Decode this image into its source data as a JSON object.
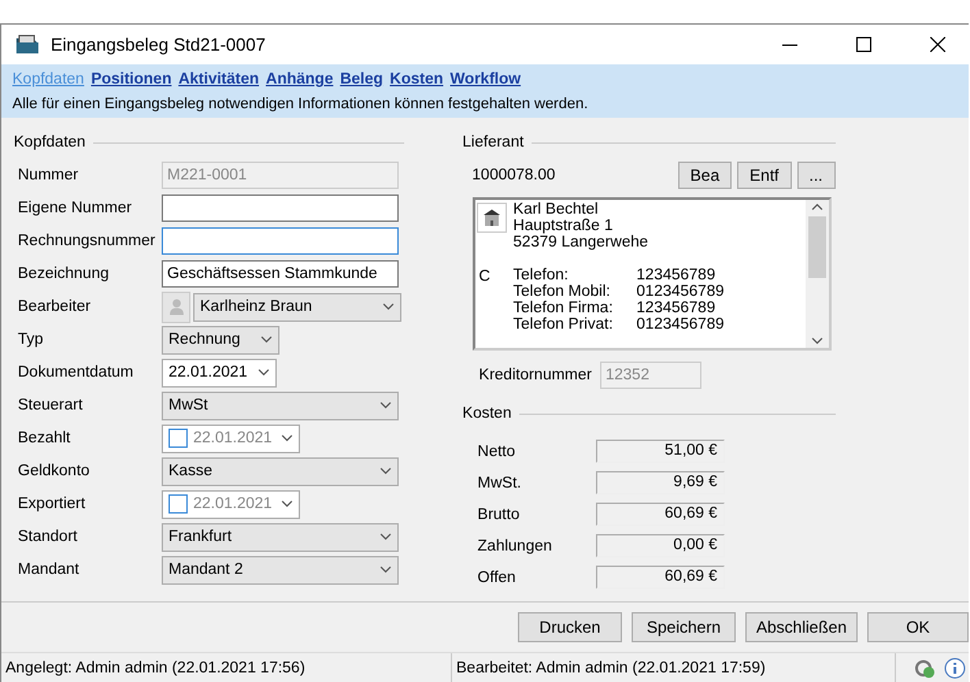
{
  "window": {
    "title": "Eingangsbeleg Std21-0007"
  },
  "nav": {
    "links": [
      {
        "label": "Kopfdaten",
        "selected": true
      },
      {
        "label": "Positionen",
        "selected": false
      },
      {
        "label": "Aktivitäten",
        "selected": false
      },
      {
        "label": "Anhänge",
        "selected": false
      },
      {
        "label": "Beleg",
        "selected": false
      },
      {
        "label": "Kosten",
        "selected": false
      },
      {
        "label": "Workflow",
        "selected": false
      }
    ],
    "description": "Alle für einen Eingangsbeleg notwendigen Informationen können festgehalten werden."
  },
  "kopfdaten": {
    "title": "Kopfdaten",
    "fields": [
      {
        "kind": "text",
        "label": "Nummer",
        "value": "M221-0001",
        "disabled": true,
        "focused": false
      },
      {
        "kind": "text",
        "label": "Eigene Nummer",
        "disabled": false,
        "focused": false
      },
      {
        "kind": "text",
        "label": "Rechnungsnummer",
        "disabled": false,
        "focused": true
      },
      {
        "kind": "text",
        "label": "Bezeichnung",
        "value": "Geschäftsessen Stammkunde",
        "disabled": false,
        "focused": false
      },
      {
        "kind": "person",
        "label": "Bearbeiter",
        "value": "Karlheinz Braun"
      },
      {
        "kind": "select",
        "label": "Typ",
        "value": "Rechnung",
        "short": true
      },
      {
        "kind": "date",
        "label": "Dokumentdatum",
        "value": "22.01.2021"
      },
      {
        "kind": "select",
        "label": "Steuerart",
        "value": "MwSt",
        "short": false
      },
      {
        "kind": "checkdate",
        "label": "Bezahlt",
        "value": "22.01.2021",
        "checked": false
      },
      {
        "kind": "select",
        "label": "Geldkonto",
        "value": "Kasse",
        "short": false
      },
      {
        "kind": "checkdate",
        "label": "Exportiert",
        "value": "22.01.2021",
        "checked": false
      },
      {
        "kind": "select",
        "label": "Standort",
        "value": "Frankfurt",
        "short": false
      },
      {
        "kind": "select",
        "label": "Mandant",
        "value": "Mandant 2",
        "short": false
      }
    ]
  },
  "lieferant": {
    "title": "Lieferant",
    "number": "1000078.00",
    "buttons": [
      "Bea",
      "Entf",
      "..."
    ],
    "card": {
      "address": [
        "Karl Bechtel",
        "Hauptstraße 1",
        "52379 Langerwehe"
      ],
      "marker": "C",
      "phones": [
        {
          "label": "Telefon:",
          "value": "123456789"
        },
        {
          "label": "Telefon Mobil:",
          "value": "0123456789"
        },
        {
          "label": "Telefon Firma:",
          "value": "123456789"
        },
        {
          "label": "Telefon Privat:",
          "value": "0123456789"
        }
      ]
    },
    "kreditor": {
      "label": "Kreditornummer",
      "value": "12352"
    }
  },
  "kosten": {
    "title": "Kosten",
    "rows": [
      {
        "label": "Netto",
        "value": "51,00 €"
      },
      {
        "label": "MwSt.",
        "value": "9,69 €"
      },
      {
        "label": "Brutto",
        "value": "60,69 €"
      },
      {
        "label": "Zahlungen",
        "value": "0,00 €"
      },
      {
        "label": "Offen",
        "value": "60,69 €"
      }
    ]
  },
  "buttons": [
    "Drucken",
    "Speichern",
    "Abschließen",
    "OK"
  ],
  "status_bar": {
    "created": "Angelegt: Admin admin (22.01.2021 17:56)",
    "edited": "Bearbeitet:  Admin admin (22.01.2021 17:59)"
  }
}
